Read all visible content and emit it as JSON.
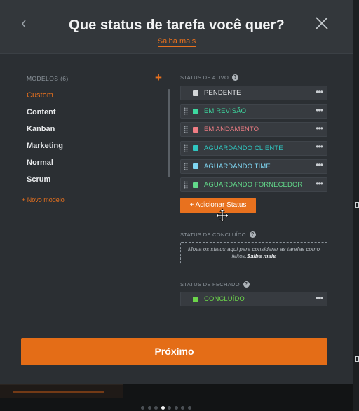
{
  "header": {
    "title": "Que status de tarefa você quer?",
    "learn_more": "Saiba mais",
    "back_icon": "chevron-left-icon",
    "close_icon": "close-icon"
  },
  "models": {
    "label": "MODELOS (6)",
    "add_icon": "plus-icon",
    "items": [
      {
        "label": "Custom",
        "active": true
      },
      {
        "label": "Content",
        "active": false
      },
      {
        "label": "Kanban",
        "active": false
      },
      {
        "label": "Marketing",
        "active": false
      },
      {
        "label": "Normal",
        "active": false
      },
      {
        "label": "Scrum",
        "active": false
      }
    ],
    "new_model": "+ Novo modelo"
  },
  "active_section": {
    "label": "STATUS DE ATIVO",
    "statuses": [
      {
        "name": "PENDENTE",
        "color": "#d3d6d8",
        "text_color": "#e6e8ea",
        "draggable": false
      },
      {
        "name": "EM REVISÃO",
        "color": "#3dd9a0",
        "text_color": "#3dd9a0",
        "draggable": true
      },
      {
        "name": "EM ANDAMENTO",
        "color": "#ef7d84",
        "text_color": "#ef7d84",
        "draggable": true
      },
      {
        "name": "AGUARDANDO CLIENTE",
        "color": "#2fc7c1",
        "text_color": "#2fc7c1",
        "draggable": true
      },
      {
        "name": "AGUARDANDO TIME",
        "color": "#7fd6f2",
        "text_color": "#7fd6f2",
        "draggable": true
      },
      {
        "name": "AGUARDANDO FORNECEDOR",
        "color": "#62d98a",
        "text_color": "#62d98a",
        "draggable": true
      }
    ]
  },
  "add_status": "+ Adicionar Status",
  "done_section": {
    "label": "STATUS DE CONCLUÍDO",
    "dropzone_text": "Mova os status aqui para considerar as tarefas como feitos.",
    "dropzone_link": "Saiba mais"
  },
  "closed_section": {
    "label": "STATUS DE FECHADO",
    "statuses": [
      {
        "name": "CONCLUÍDO",
        "color": "#6bd44a",
        "text_color": "#6bd44a",
        "draggable": false
      }
    ]
  },
  "next_button": "Próximo",
  "pagination": {
    "total": 8,
    "active": 4
  },
  "colors": {
    "accent": "#e8711e",
    "modal_bg": "#2b2f33",
    "header_bg": "#33373b"
  }
}
